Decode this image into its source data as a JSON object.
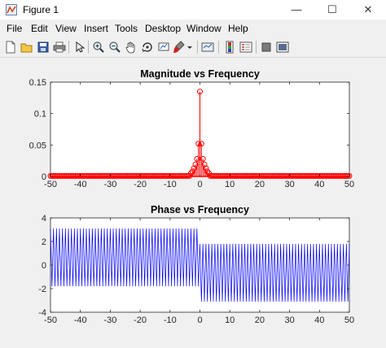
{
  "window": {
    "title": "Figure 1",
    "minimize": "—",
    "maximize": "☐",
    "close": "✕"
  },
  "menu": [
    "File",
    "Edit",
    "View",
    "Insert",
    "Tools",
    "Desktop",
    "Window",
    "Help"
  ],
  "toolbar": {
    "icons": [
      "new-figure-icon",
      "open-file-icon",
      "save-icon",
      "print-icon",
      "pointer-icon",
      "zoom-in-icon",
      "zoom-out-icon",
      "pan-icon",
      "rotate-3d-icon",
      "brush-icon",
      "dropdown-arrow-icon",
      "link-plot-icon",
      "colorbar-icon",
      "legend-icon",
      "hide-plot-tools-icon",
      "show-plot-tools-icon"
    ]
  },
  "colors": {
    "magnitude": "#ff0000",
    "phase": "#0000ff",
    "axes_bg": "#ffffff",
    "figure_bg": "#f0f0f0"
  },
  "chart_data": [
    {
      "type": "stem",
      "title": "Magnitude vs Frequency",
      "xlabel": "",
      "ylabel": "",
      "xlim": [
        -50,
        50
      ],
      "ylim": [
        0,
        0.15
      ],
      "xticks": [
        -50,
        -40,
        -30,
        -20,
        -10,
        0,
        10,
        20,
        30,
        40,
        50
      ],
      "yticks": [
        0,
        0.05,
        0.1,
        0.15
      ],
      "ytick_labels": [
        "0",
        "0.05",
        "0.1",
        "0.15"
      ],
      "sample_step": 0.5,
      "peaks": [
        {
          "x": 0,
          "y": 0.135
        },
        {
          "x": -0.5,
          "y": 0.052
        },
        {
          "x": 0.5,
          "y": 0.052
        },
        {
          "x": -1,
          "y": 0.028
        },
        {
          "x": 1,
          "y": 0.028
        },
        {
          "x": -1.5,
          "y": 0.019
        },
        {
          "x": 1.5,
          "y": 0.019
        },
        {
          "x": -2,
          "y": 0.013
        },
        {
          "x": 2,
          "y": 0.013
        },
        {
          "x": -2.5,
          "y": 0.008
        },
        {
          "x": 2.5,
          "y": 0.008
        },
        {
          "x": -3,
          "y": 0.005
        },
        {
          "x": 3,
          "y": 0.005
        }
      ],
      "baseline_value": 0.0008,
      "grid": false
    },
    {
      "type": "line",
      "title": "Phase vs Frequency",
      "xlabel": "",
      "ylabel": "",
      "xlim": [
        -50,
        50
      ],
      "ylim": [
        -4,
        4
      ],
      "xticks": [
        -50,
        -40,
        -30,
        -20,
        -10,
        0,
        10,
        20,
        30,
        40,
        50
      ],
      "yticks": [
        -4,
        -2,
        0,
        2,
        4
      ],
      "ytick_labels": [
        "-4",
        "-2",
        "0",
        "2",
        "4"
      ],
      "sample_step": 0.5,
      "envelope": {
        "left": {
          "upper": 3.1,
          "lower": -1.8
        },
        "right": {
          "upper": 1.8,
          "lower": -3.1
        }
      },
      "grid": false
    }
  ]
}
